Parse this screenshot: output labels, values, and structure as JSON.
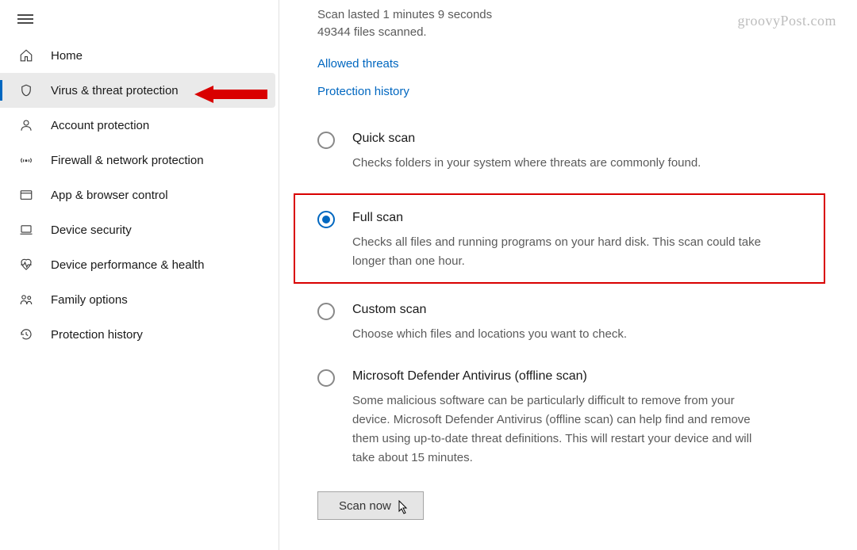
{
  "watermark": "groovyPost.com",
  "sidebar": {
    "items": [
      {
        "label": "Home",
        "icon": "home-icon"
      },
      {
        "label": "Virus & threat protection",
        "icon": "shield-icon",
        "selected": true
      },
      {
        "label": "Account protection",
        "icon": "person-icon"
      },
      {
        "label": "Firewall & network protection",
        "icon": "antenna-icon"
      },
      {
        "label": "App & browser control",
        "icon": "app-icon"
      },
      {
        "label": "Device security",
        "icon": "laptop-icon"
      },
      {
        "label": "Device performance & health",
        "icon": "heart-icon"
      },
      {
        "label": "Family options",
        "icon": "family-icon"
      },
      {
        "label": "Protection history",
        "icon": "history-icon"
      }
    ]
  },
  "main": {
    "status_line1": "Scan lasted 1 minutes 9 seconds",
    "status_line2": "49344 files scanned.",
    "links": {
      "allowed_threats": "Allowed threats",
      "protection_history": "Protection history"
    },
    "options": [
      {
        "title": "Quick scan",
        "desc": "Checks folders in your system where threats are commonly found.",
        "checked": false,
        "highlight": false
      },
      {
        "title": "Full scan",
        "desc": "Checks all files and running programs on your hard disk. This scan could take longer than one hour.",
        "checked": true,
        "highlight": true
      },
      {
        "title": "Custom scan",
        "desc": "Choose which files and locations you want to check.",
        "checked": false,
        "highlight": false
      },
      {
        "title": "Microsoft Defender Antivirus (offline scan)",
        "desc": "Some malicious software can be particularly difficult to remove from your device. Microsoft Defender Antivirus (offline scan) can help find and remove them using up-to-date threat definitions. This will restart your device and will take about 15 minutes.",
        "checked": false,
        "highlight": false
      }
    ],
    "scan_button": "Scan now"
  }
}
